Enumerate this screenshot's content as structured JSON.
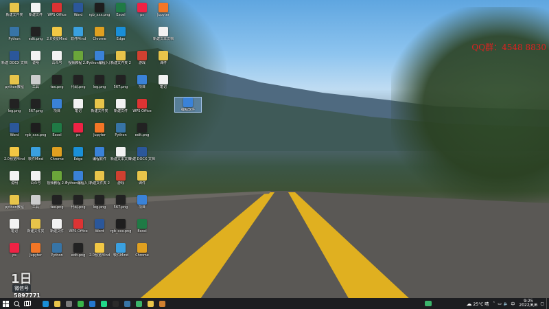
{
  "desktop": {
    "watermark_text": "QQ群：4548 8830",
    "selected_icon_label": "编程软件",
    "icons": [
      {
        "label": "新建文件夹",
        "color": "#e8c44a"
      },
      {
        "label": "新建文件",
        "color": "#f2f2f2"
      },
      {
        "label": "WPS Office",
        "color": "#d33"
      },
      {
        "label": "Word",
        "color": "#2b579a"
      },
      {
        "label": "rgb_xxx.png",
        "color": "#1e1e1e"
      },
      {
        "label": "Excel",
        "color": "#1f7a45"
      },
      {
        "label": "ps",
        "color": "#e24"
      },
      {
        "label": "Jupyter",
        "color": "#f37626"
      },
      {
        "label": "Python",
        "color": "#3774a6"
      },
      {
        "label": "edit.png",
        "color": "#222"
      },
      {
        "label": "2.0预览Mind",
        "color": "#f2c744"
      },
      {
        "label": "软件Mind",
        "color": "#3aa0e0"
      },
      {
        "label": "Chrome",
        "color": "#e0a020"
      },
      {
        "label": "Edge",
        "color": "#1a8fd8"
      },
      {
        "label": "编程软件",
        "color": "#3a82d8"
      },
      {
        "label": "新建文本文档",
        "color": "#f2f2f2"
      },
      {
        "label": "新建 DOCX 文档.docx",
        "color": "#2b579a"
      },
      {
        "label": "说明",
        "color": "#f2f2f2"
      },
      {
        "label": "公众号",
        "color": "#f2f2f2"
      },
      {
        "label": "视频教程 2.0",
        "color": "#6ba63a"
      },
      {
        "label": "Python编程入门",
        "color": "#3a82d8"
      },
      {
        "label": "新建文件夹 2",
        "color": "#e8c44a"
      },
      {
        "label": "游戏",
        "color": "#d04030"
      },
      {
        "label": "课件",
        "color": "#e8c44a"
      },
      {
        "label": "python教程",
        "color": "#e8c44a"
      },
      {
        "label": "工具",
        "color": "#ccc"
      },
      {
        "label": "tex.png",
        "color": "#222"
      },
      {
        "label": "代码.png",
        "color": "#222"
      },
      {
        "label": "log.png",
        "color": "#222"
      },
      {
        "label": "567.png",
        "color": "#222"
      },
      {
        "label": "项目",
        "color": "#3a82d8"
      },
      {
        "label": "笔记",
        "color": "#f2f2f2"
      }
    ]
  },
  "branding": {
    "overlay_logo": "1日",
    "overlay_pill": "微信号",
    "overlay_number": "5897771"
  },
  "taskbar": {
    "start_icon": "windows-icon",
    "apps": [
      {
        "name": "edge-icon",
        "color": "#1a8fd8"
      },
      {
        "name": "file-explorer-icon",
        "color": "#e8c44a"
      },
      {
        "name": "settings-icon",
        "color": "#7a7a7a"
      },
      {
        "name": "wechat-icon",
        "color": "#3ab54a"
      },
      {
        "name": "vscode-icon",
        "color": "#2477cf"
      },
      {
        "name": "pycharm-icon",
        "color": "#21d789"
      },
      {
        "name": "obs-icon",
        "color": "#2a2a2a"
      },
      {
        "name": "python-icon",
        "color": "#3774a6"
      },
      {
        "name": "green-app-icon",
        "color": "#3bb46b"
      },
      {
        "name": "image-viewer-icon",
        "color": "#e8c44a"
      },
      {
        "name": "archive-icon",
        "color": "#d08030"
      }
    ],
    "weather": "25°C 晴",
    "time": "9:25",
    "date": "2022/6/6"
  }
}
